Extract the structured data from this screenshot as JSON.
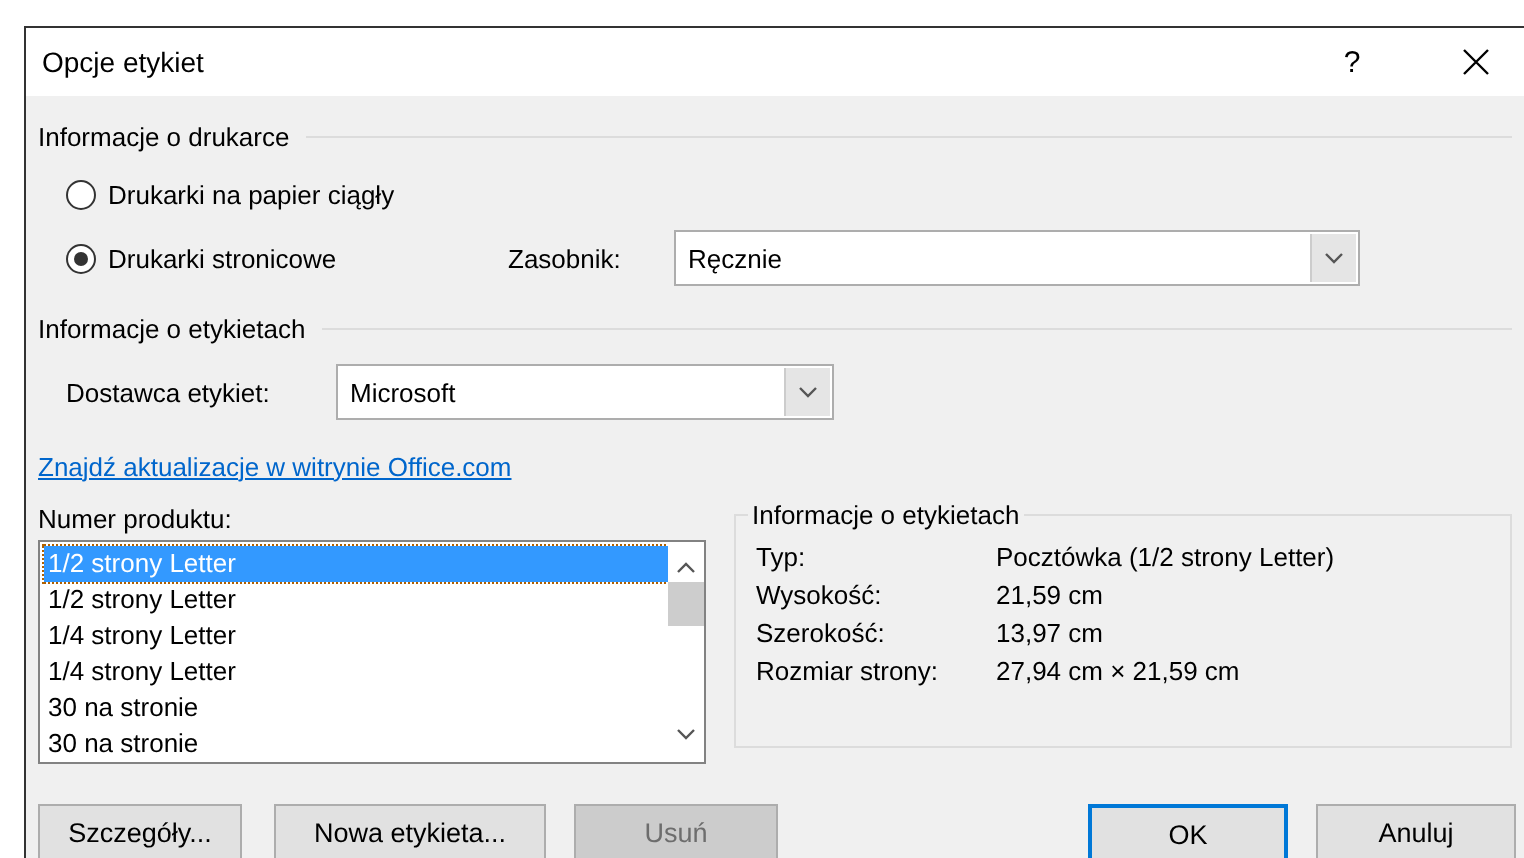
{
  "window": {
    "title": "Opcje etykiet",
    "help": "?"
  },
  "printer_info": {
    "title": "Informacje o drukarce",
    "options": [
      {
        "label": "Drukarki na papier ciągły",
        "selected": false
      },
      {
        "label": "Drukarki stronicowe",
        "selected": true
      }
    ],
    "tray": {
      "label": "Zasobnik:",
      "value": "Ręcznie"
    }
  },
  "label_info": {
    "title": "Informacje o etykietach",
    "vendor": {
      "label": "Dostawca etykiet:",
      "value": "Microsoft"
    },
    "link": "Znajdź aktualizacje w witrynie Office.com"
  },
  "product_list": {
    "label": "Numer produktu:",
    "items": [
      {
        "label": "1/2 strony Letter",
        "selected": true
      },
      {
        "label": "1/2 strony Letter",
        "selected": false
      },
      {
        "label": "1/4 strony Letter",
        "selected": false
      },
      {
        "label": "1/4 strony Letter",
        "selected": false
      },
      {
        "label": "30 na stronie",
        "selected": false
      },
      {
        "label": "30 na stronie",
        "selected": false
      }
    ]
  },
  "details": {
    "title": "Informacje o etykietach",
    "rows": [
      {
        "label": "Typ:",
        "value": "Pocztówka (1/2 strony Letter)"
      },
      {
        "label": "Wysokość:",
        "value": "21,59 cm"
      },
      {
        "label": "Szerokość:",
        "value": "13,97 cm"
      },
      {
        "label": "Rozmiar strony:",
        "value": "27,94 cm × 21,59 cm"
      }
    ]
  },
  "buttons": [
    {
      "label": "Szczegóły...",
      "disabled": false,
      "default": false
    },
    {
      "label": "Nowa etykieta...",
      "disabled": false,
      "default": false
    },
    {
      "label": "Usuń",
      "disabled": true,
      "default": false
    },
    {
      "label": "OK",
      "disabled": false,
      "default": true
    },
    {
      "label": "Anuluj",
      "disabled": false,
      "default": false
    }
  ]
}
